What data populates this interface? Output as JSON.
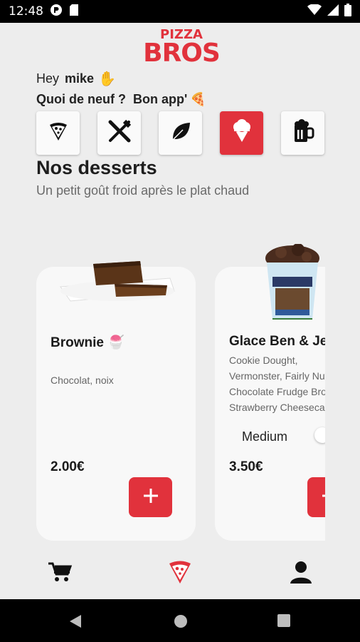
{
  "status_bar": {
    "time": "12:48"
  },
  "logo": {
    "line1": "PIZZA",
    "line2": "BROS"
  },
  "greeting": {
    "hey": "Hey",
    "name": "mike",
    "emoji": "✋"
  },
  "subgreeting": {
    "text1": "Quoi de neuf ?",
    "text2": "Bon app'",
    "emoji": "🍕"
  },
  "categories": [
    {
      "icon": "pizza-slice-icon",
      "active": false
    },
    {
      "icon": "fork-knife-icon",
      "active": false
    },
    {
      "icon": "leaf-icon",
      "active": false
    },
    {
      "icon": "ice-cream-icon",
      "active": true
    },
    {
      "icon": "beer-mug-icon",
      "active": false
    }
  ],
  "section": {
    "title": "Nos desserts",
    "subtitle": "Un petit goût froid après le plat chaud"
  },
  "products": [
    {
      "name": "Brownie 🍧",
      "description": "Chocolat, noix",
      "price": "2.00€",
      "add_label": "+"
    },
    {
      "name": "Glace Ben & Jerry's",
      "description_lines": [
        "Cookie Dought,",
        "Vermonster, Fairly Nuts,",
        "Chocolate Frudge Brownie,",
        "Strawberry Cheesecake"
      ],
      "size_label": "Medium",
      "price": "3.50€",
      "add_label": "+"
    }
  ],
  "bottom_nav": [
    {
      "icon": "cart-icon",
      "active": false
    },
    {
      "icon": "pizza-nav-icon",
      "active": true
    },
    {
      "icon": "user-icon",
      "active": false
    }
  ],
  "colors": {
    "accent": "#e1323c",
    "background": "#ededed",
    "card": "#f8f8f8"
  }
}
